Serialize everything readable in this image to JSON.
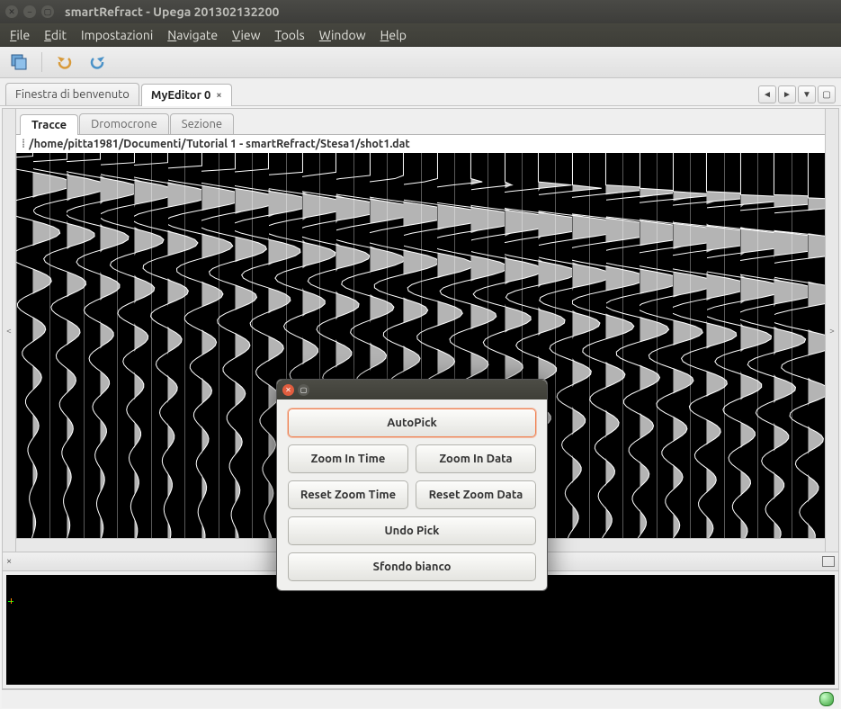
{
  "window": {
    "title": "smartRefract - Upega 201302132200"
  },
  "menu": {
    "file": "File",
    "edit": "Edit",
    "impostazioni": "Impostazioni",
    "navigate": "Navigate",
    "view": "View",
    "tools": "Tools",
    "window": "Window",
    "help": "Help"
  },
  "editor_tabs": {
    "welcome": "Finestra di benvenuto",
    "editor0": "MyEditor 0"
  },
  "inner_tabs": {
    "tracce": "Tracce",
    "dromocrone": "Dromocrone",
    "sezione": "Sezione"
  },
  "path": "/home/pitta1981/Documenti/Tutorial 1 - smartRefract/Stesa1/shot1.dat",
  "side_handles": {
    "left": "<",
    "right": ">"
  },
  "dialog": {
    "autopick": "AutoPick",
    "zoom_in_time": "Zoom In Time",
    "zoom_in_data": "Zoom In Data",
    "reset_zoom_time": "Reset Zoom Time",
    "reset_zoom_data": "Reset Zoom Data",
    "undo_pick": "Undo Pick",
    "sfondo_bianco": "Sfondo bianco"
  },
  "tab_nav": {
    "prev": "◄",
    "next": "►",
    "down": "▼",
    "max": "▢"
  },
  "panel_split": {
    "close": "×"
  }
}
